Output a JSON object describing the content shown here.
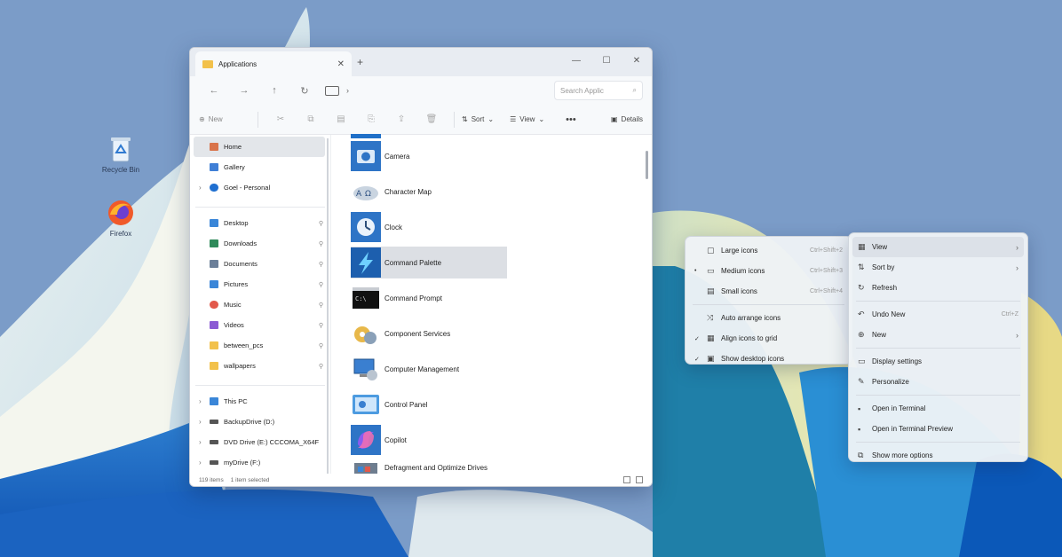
{
  "desktop": {
    "icons": [
      {
        "label": "Recycle Bin",
        "icon": "recycle-bin-icon"
      },
      {
        "label": "Firefox",
        "icon": "firefox-icon"
      }
    ]
  },
  "explorer": {
    "tab_title": "Applications",
    "search_placeholder": "Search Applic",
    "toolbar": {
      "new_label": "New",
      "sort_label": "Sort",
      "view_label": "View",
      "more_label": "•••",
      "details_label": "Details"
    },
    "sidebar": {
      "top": [
        {
          "label": "Home",
          "color": "#d9734a",
          "selected": true,
          "chevron": ""
        },
        {
          "label": "Gallery",
          "color": "#3f7fd6",
          "selected": false,
          "chevron": ""
        },
        {
          "label": "Goel - Personal",
          "color": "#1f6fd0",
          "selected": false,
          "chevron": "›"
        }
      ],
      "pinned": [
        {
          "label": "Desktop",
          "color": "#3a86d8"
        },
        {
          "label": "Downloads",
          "color": "#2f8a5a"
        },
        {
          "label": "Documents",
          "color": "#6b7f99"
        },
        {
          "label": "Pictures",
          "color": "#3a86d8"
        },
        {
          "label": "Music",
          "color": "#e2584a"
        },
        {
          "label": "Videos",
          "color": "#8b5bd4"
        },
        {
          "label": "between_pcs",
          "color": "#f2c14b"
        },
        {
          "label": "wallpapers",
          "color": "#f2c14b"
        }
      ],
      "drives": [
        {
          "label": "This PC",
          "color": "#3a86d8"
        },
        {
          "label": "BackupDrive (D:)",
          "color": "#555"
        },
        {
          "label": "DVD Drive (E:) CCCOMA_X64F",
          "color": "#555"
        },
        {
          "label": "myDrive (F:)",
          "color": "#555"
        }
      ]
    },
    "files": [
      {
        "label": "Camera",
        "icon": "camera-icon",
        "selected": false
      },
      {
        "label": "Character Map",
        "icon": "character-map-icon",
        "selected": false
      },
      {
        "label": "Clock",
        "icon": "clock-icon",
        "selected": false
      },
      {
        "label": "Command Palette",
        "icon": "command-palette-icon",
        "selected": true
      },
      {
        "label": "Command Prompt",
        "icon": "command-prompt-icon",
        "selected": false
      },
      {
        "label": "Component Services",
        "icon": "component-services-icon",
        "selected": false
      },
      {
        "label": "Computer Management",
        "icon": "computer-management-icon",
        "selected": false
      },
      {
        "label": "Control Panel",
        "icon": "control-panel-icon",
        "selected": false
      },
      {
        "label": "Copilot",
        "icon": "copilot-icon",
        "selected": false
      },
      {
        "label": "Defragment and Optimize Drives",
        "icon": "defragment-icon",
        "selected": false
      }
    ],
    "status": {
      "items_count": "119 items",
      "selected": "1 item selected"
    }
  },
  "view_submenu": [
    {
      "label": "Large icons",
      "shortcut": "Ctrl+Shift+2",
      "icon": "large-icons-icon",
      "checked": false
    },
    {
      "label": "Medium icons",
      "shortcut": "Ctrl+Shift+3",
      "icon": "medium-icons-icon",
      "checked": true
    },
    {
      "label": "Small icons",
      "shortcut": "Ctrl+Shift+4",
      "icon": "small-icons-icon",
      "checked": false
    },
    {
      "label": "Auto arrange icons",
      "shortcut": "",
      "icon": "auto-arrange-icon",
      "checked": false
    },
    {
      "label": "Align icons to grid",
      "shortcut": "",
      "icon": "align-grid-icon",
      "checked": true
    },
    {
      "label": "Show desktop icons",
      "shortcut": "",
      "icon": "show-desktop-icon",
      "checked": true
    }
  ],
  "context_menu": [
    {
      "label": "View",
      "shortcut": "",
      "icon": "view-icon",
      "arrow": true,
      "highlight": true
    },
    {
      "label": "Sort by",
      "shortcut": "",
      "icon": "sort-icon",
      "arrow": true,
      "highlight": false
    },
    {
      "label": "Refresh",
      "shortcut": "",
      "icon": "refresh-icon",
      "arrow": false,
      "highlight": false
    },
    {
      "sep": true
    },
    {
      "label": "Undo New",
      "shortcut": "Ctrl+Z",
      "icon": "undo-icon",
      "arrow": false,
      "highlight": false
    },
    {
      "label": "New",
      "shortcut": "",
      "icon": "new-icon",
      "arrow": true,
      "highlight": false
    },
    {
      "sep": true
    },
    {
      "label": "Display settings",
      "shortcut": "",
      "icon": "display-settings-icon",
      "arrow": false,
      "highlight": false
    },
    {
      "label": "Personalize",
      "shortcut": "",
      "icon": "personalize-icon",
      "arrow": false,
      "highlight": false
    },
    {
      "sep": true
    },
    {
      "label": "Open in Terminal",
      "shortcut": "",
      "icon": "terminal-icon",
      "arrow": false,
      "highlight": false
    },
    {
      "label": "Open in Terminal Preview",
      "shortcut": "",
      "icon": "terminal-preview-icon",
      "arrow": false,
      "highlight": false
    },
    {
      "sep": true
    },
    {
      "label": "Show more options",
      "shortcut": "",
      "icon": "more-options-icon",
      "arrow": false,
      "highlight": false
    }
  ]
}
